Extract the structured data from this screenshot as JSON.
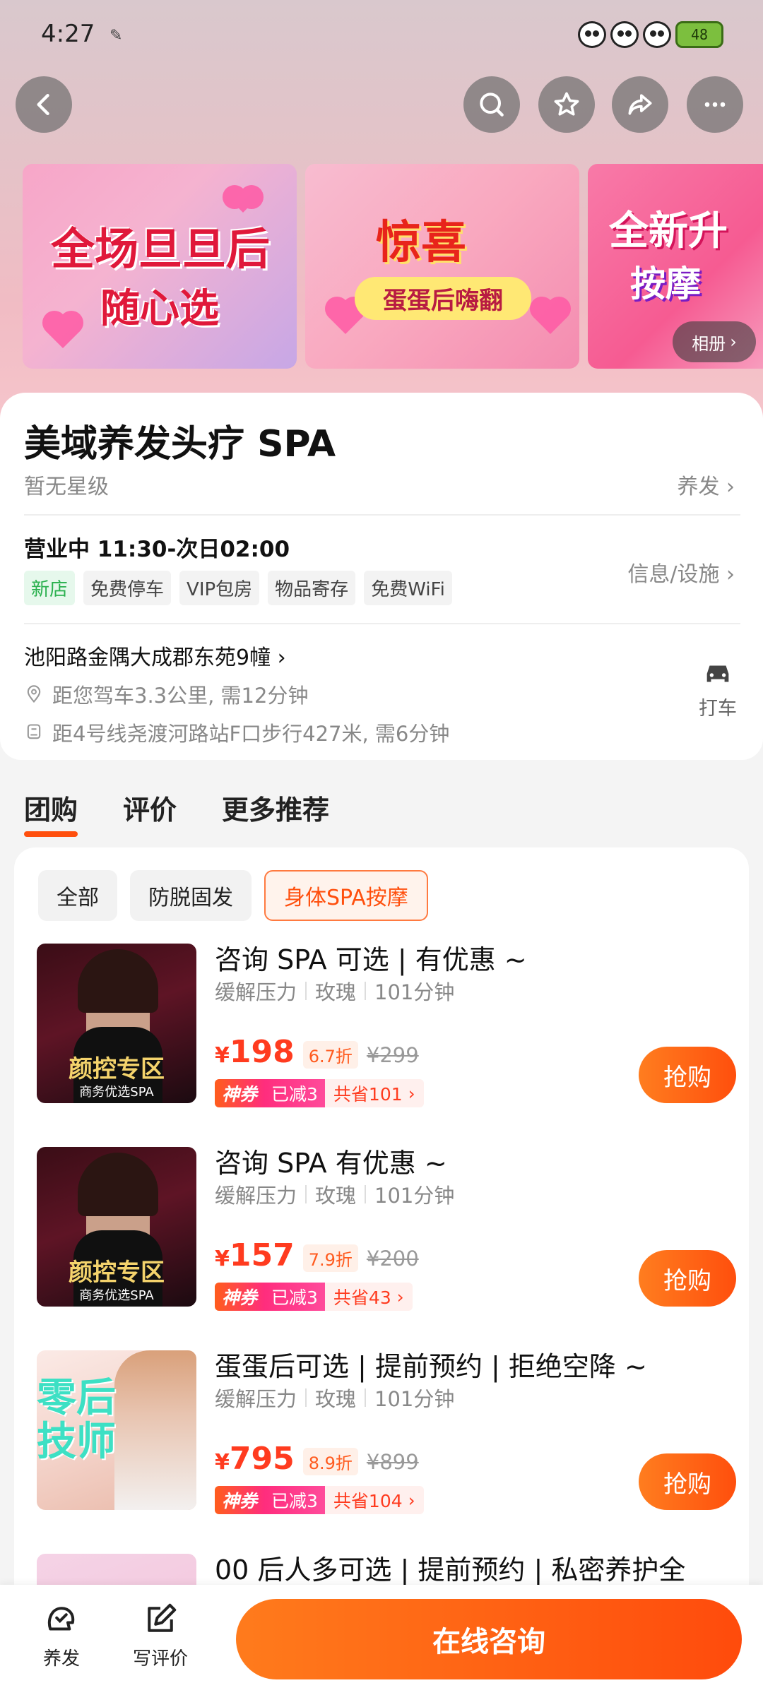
{
  "status_bar": {
    "time": "4:27",
    "battery": "48"
  },
  "banners": [
    {
      "line1": "全场旦旦后",
      "line2": "随心选"
    },
    {
      "line1": "惊喜",
      "line2": "蛋蛋后嗨翻"
    },
    {
      "line1": "全新升",
      "line2": "按摩"
    }
  ],
  "album_label": "相册",
  "shop": {
    "title": "美域养发头疗 SPA",
    "star_level": "暂无星级",
    "category": "养发",
    "hours": "营业中 11:30-次日02:00",
    "tags": [
      "新店",
      "免费停车",
      "VIP包房",
      "物品寄存",
      "免费WiFi"
    ],
    "info_link": "信息/设施",
    "address": "池阳路金隅大成郡东苑9幢",
    "distance": "距您驾车3.3公里, 需12分钟",
    "transit": "距4号线尧渡河路站F口步行427米, 需6分钟",
    "taxi_label": "打车"
  },
  "tabs": [
    "团购",
    "评价",
    "更多推荐"
  ],
  "filters": [
    "全部",
    "防脱固发",
    "身体SPA按摩"
  ],
  "deals": [
    {
      "title": "咨询 SPA 可选 | 有优惠 ~",
      "meta": [
        "缓解压力",
        "玫瑰",
        "101分钟"
      ],
      "price": "198",
      "discount": "6.7折",
      "original": "¥299",
      "coupon_god": "神券",
      "coupon_cut": "已减3",
      "coupon_save": "共省101",
      "thumb_caption": "颜控专区",
      "thumb_sub": "商务优选SPA",
      "buy": "抢购"
    },
    {
      "title": "咨询 SPA 有优惠 ~",
      "meta": [
        "缓解压力",
        "玫瑰",
        "101分钟"
      ],
      "price": "157",
      "discount": "7.9折",
      "original": "¥200",
      "coupon_god": "神券",
      "coupon_cut": "已减3",
      "coupon_save": "共省43",
      "thumb_caption": "颜控专区",
      "thumb_sub": "商务优选SPA",
      "buy": "抢购"
    },
    {
      "title": "蛋蛋后可选 | 提前预约 | 拒绝空降 ~",
      "meta": [
        "缓解压力",
        "玫瑰",
        "101分钟"
      ],
      "price": "795",
      "discount": "8.9折",
      "original": "¥899",
      "coupon_god": "神券",
      "coupon_cut": "已减3",
      "coupon_save": "共省104",
      "thumb_caption": "零后\n技师",
      "buy": "抢购"
    },
    {
      "title": "00 后人多可选 | 提前预约 | 私密养护全"
    }
  ],
  "bottom_bar": {
    "hair_label": "养发",
    "review_label": "写评价",
    "consult_label": "在线咨询"
  },
  "colors": {
    "accent": "#ff4f0d",
    "price": "#ff3b1f",
    "new_tag": "#2bb14f"
  }
}
